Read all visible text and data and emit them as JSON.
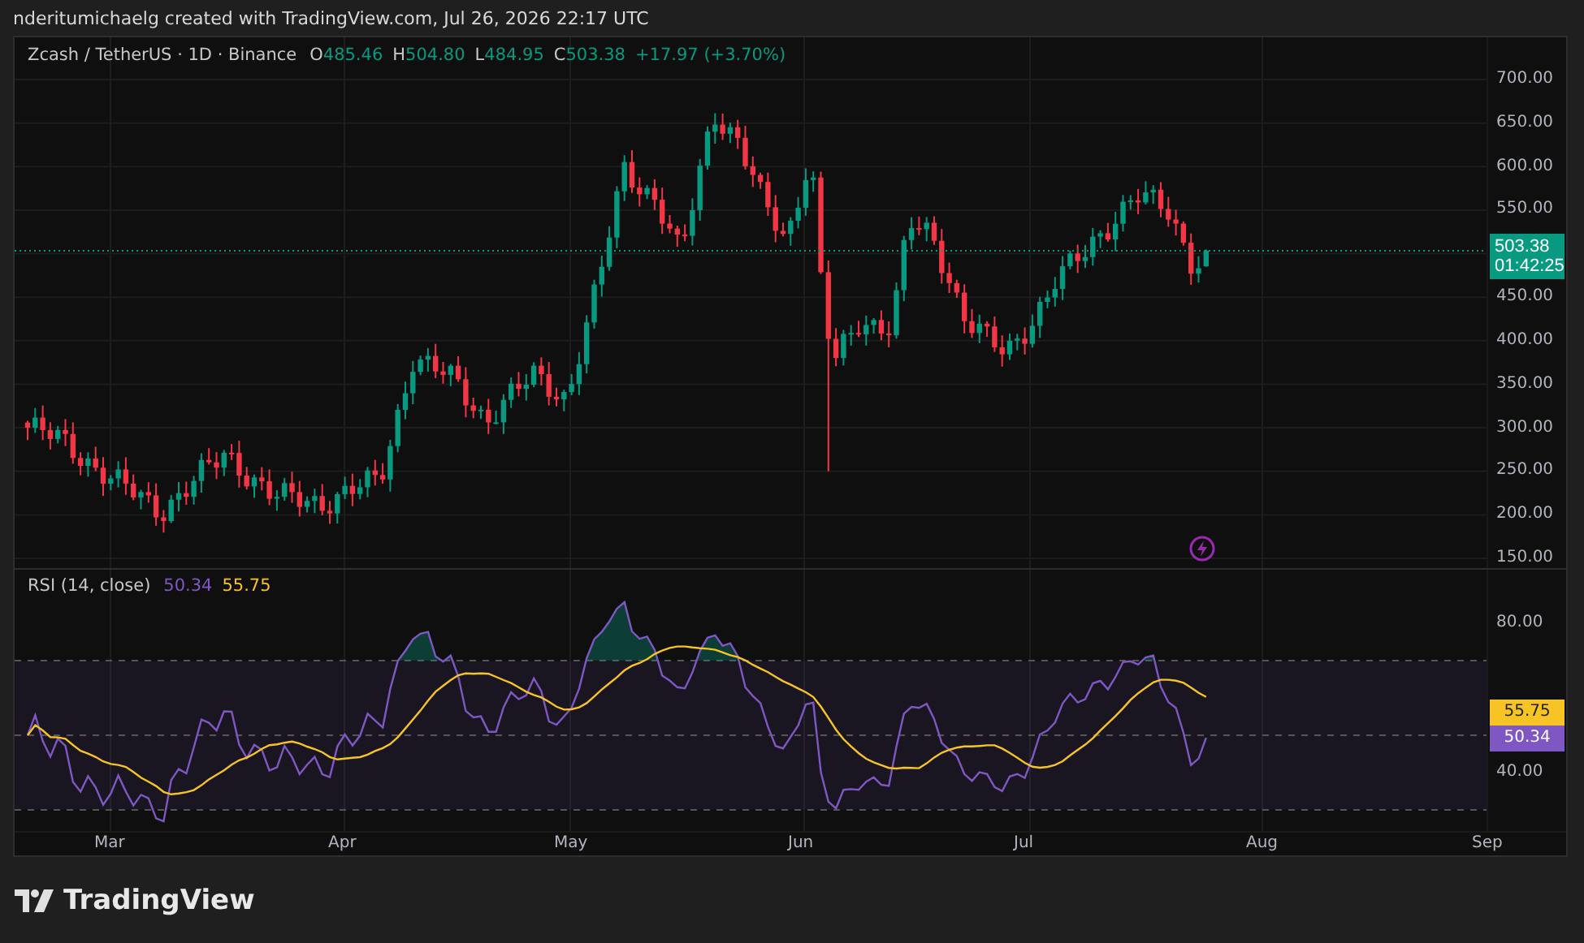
{
  "attribution": "nderitumichaelg created with TradingView.com, Jul 26, 2026 22:17 UTC",
  "legend": {
    "symbol": "Zcash / TetherUS · 1D · Binance",
    "values": [
      {
        "label": "O",
        "value": "485.46"
      },
      {
        "label": "H",
        "value": "504.80"
      },
      {
        "label": "L",
        "value": "484.95"
      },
      {
        "label": "C",
        "value": "503.38"
      }
    ],
    "change": "+17.97 (+3.70%)"
  },
  "price_axis": {
    "ticks": [
      "700.00",
      "650.00",
      "600.00",
      "550.00",
      "450.00",
      "400.00",
      "350.00",
      "300.00",
      "250.00",
      "200.00",
      "150.00"
    ]
  },
  "last_price": {
    "price": "503.38",
    "countdown": "01:42:25"
  },
  "rsi": {
    "title": "RSI (14, close)",
    "value": "50.34",
    "ma_value": "55.75",
    "ticks": [
      "80.00",
      "40.00"
    ],
    "ma_badge": "55.75",
    "value_badge": "50.34"
  },
  "time_axis": {
    "labels": [
      "Mar",
      "Apr",
      "May",
      "Jun",
      "Jul",
      "Aug",
      "Sep"
    ]
  },
  "brand": {
    "name": "TradingView"
  }
}
